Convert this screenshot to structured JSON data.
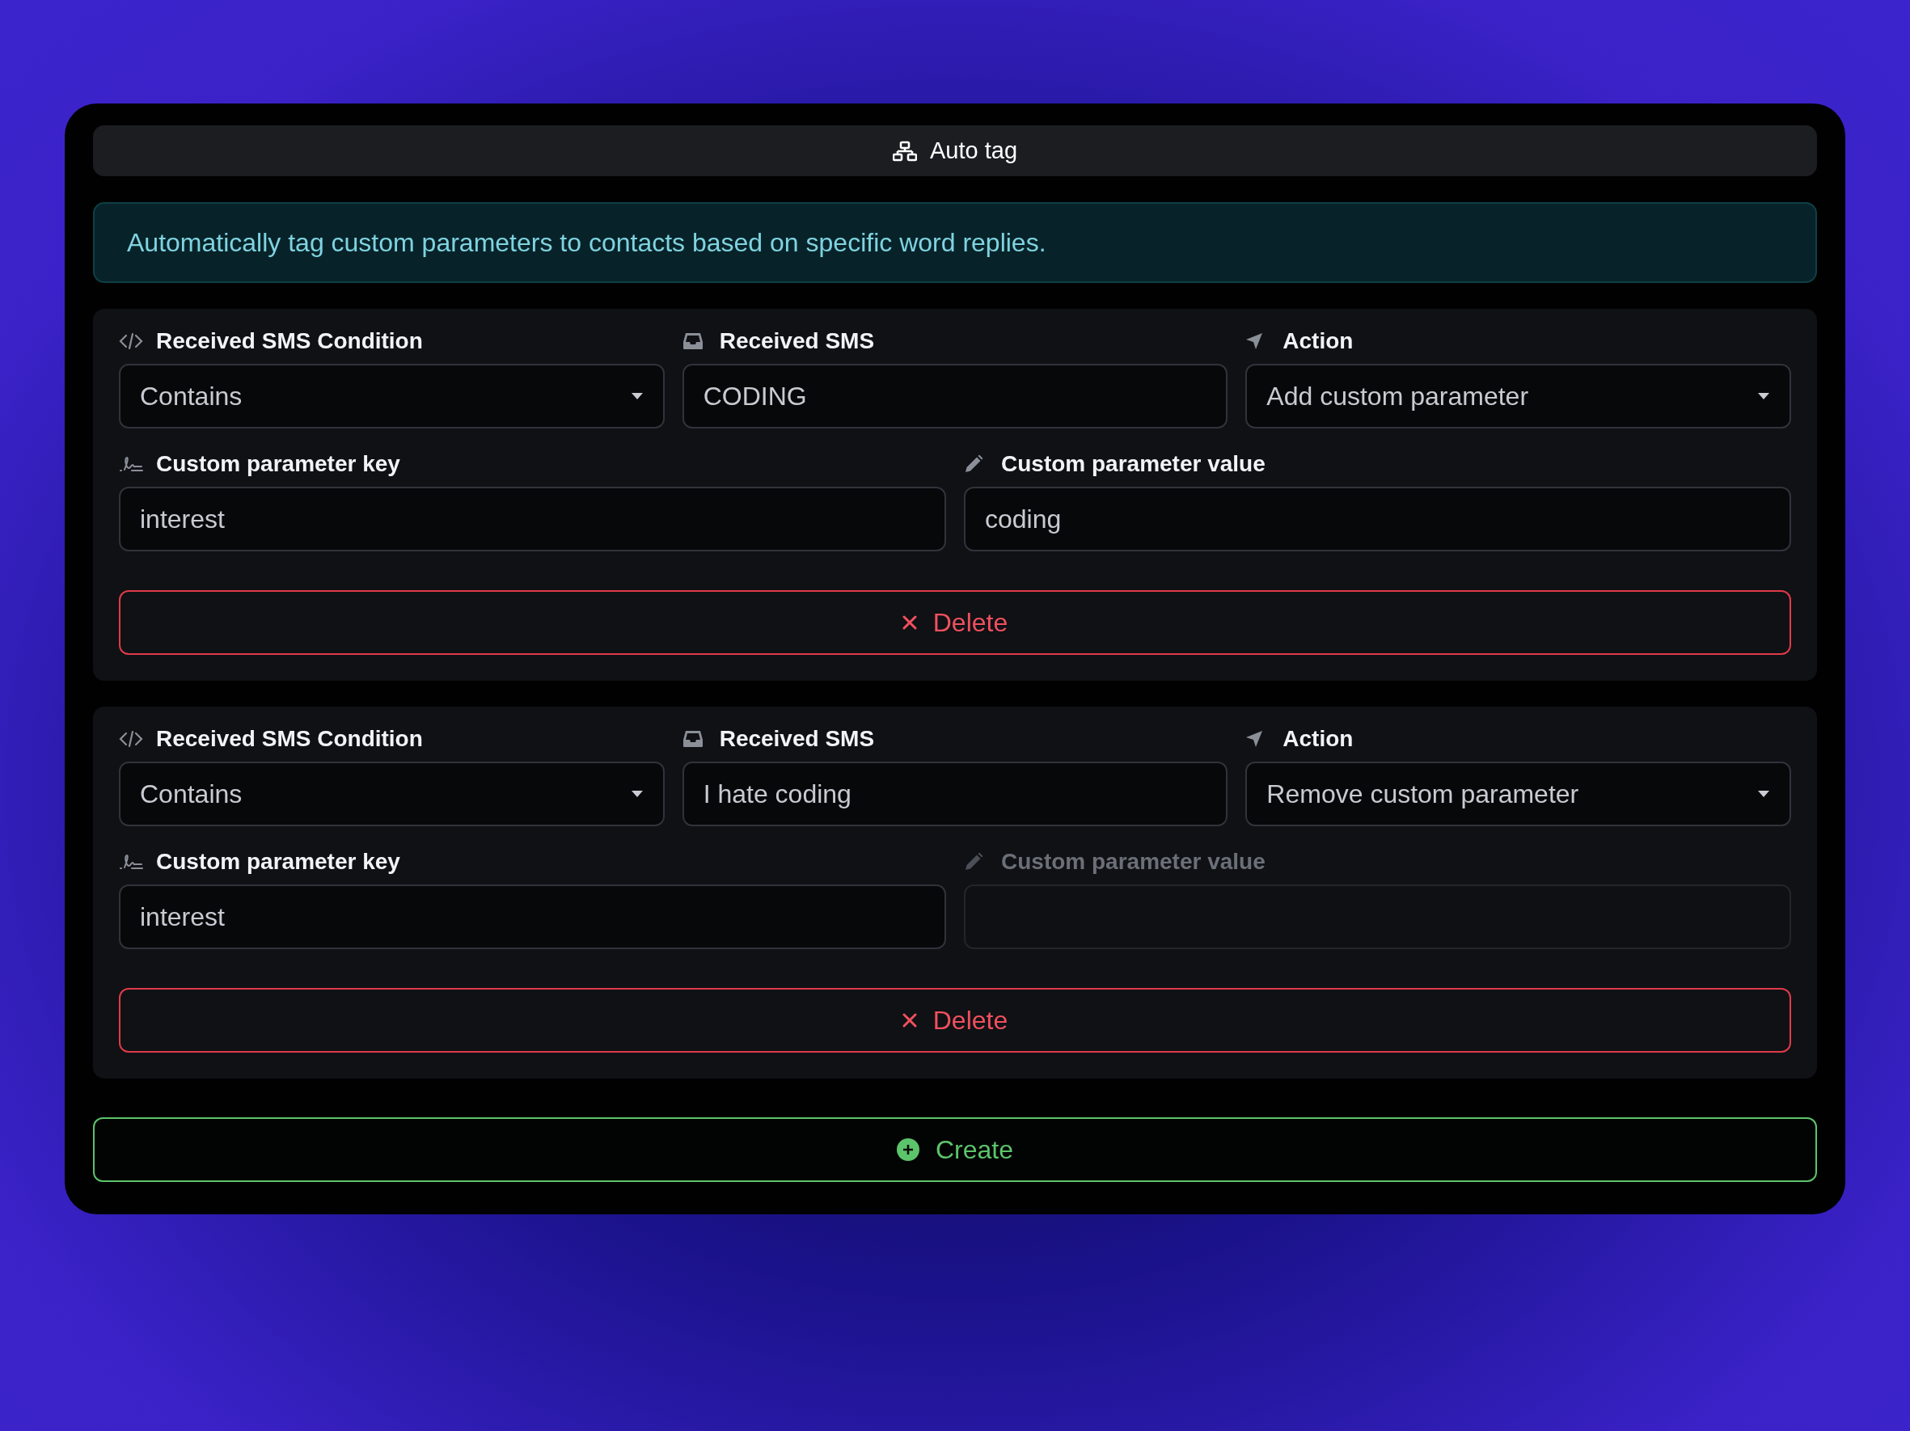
{
  "header": {
    "title": "Auto tag"
  },
  "info": "Automatically tag custom parameters to contacts based on specific word replies.",
  "rules": [
    {
      "condition": {
        "label": "Received SMS Condition",
        "value": "Contains"
      },
      "sms": {
        "label": "Received SMS",
        "value": "CODING"
      },
      "action": {
        "label": "Action",
        "value": "Add custom parameter"
      },
      "key": {
        "label": "Custom parameter key",
        "value": "interest"
      },
      "param_value": {
        "label": "Custom parameter value",
        "value": "coding",
        "disabled": false
      },
      "delete": "Delete"
    },
    {
      "condition": {
        "label": "Received SMS Condition",
        "value": "Contains"
      },
      "sms": {
        "label": "Received SMS",
        "value": "I hate coding"
      },
      "action": {
        "label": "Action",
        "value": "Remove custom parameter"
      },
      "key": {
        "label": "Custom parameter key",
        "value": "interest"
      },
      "param_value": {
        "label": "Custom parameter value",
        "disabled": true
      },
      "delete": "Delete"
    }
  ],
  "create": "Create"
}
